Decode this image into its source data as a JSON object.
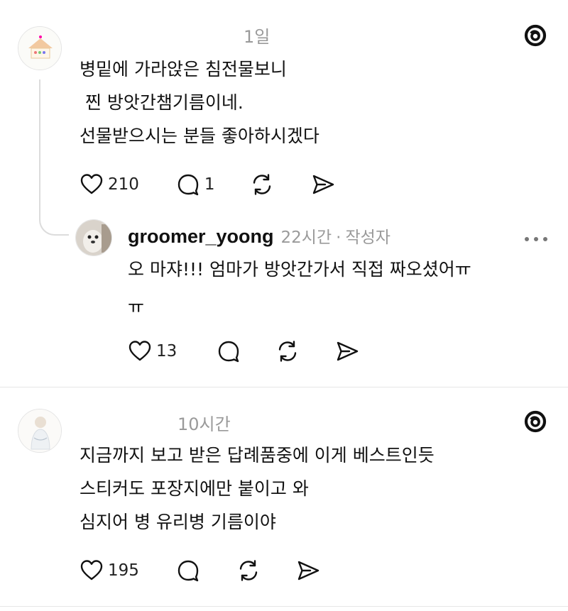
{
  "comment1": {
    "time": "1일",
    "lines": [
      "병밑에 가라앉은 침전물보니",
      " 찐 방앗간챔기름이네.",
      "선물받으시는 분들 좋아하시겠다"
    ],
    "likes": "210",
    "replies": "1"
  },
  "reply1": {
    "username": "groomer_yoong",
    "time": "22시간",
    "separator": "·",
    "author_badge": "작성자",
    "lines": [
      "오 마쟈!!! 엄마가 방앗간가서 직접 짜오셨어ㅠ",
      "ㅠ"
    ],
    "likes": "13"
  },
  "comment2": {
    "time": "10시간",
    "lines": [
      "지금까지 보고 받은 답례품중에 이게 베스트인듯",
      "스티커도 포장지에만 붙이고 와",
      "심지어 병 유리병 기름이야"
    ],
    "likes": "195"
  },
  "icons": {
    "threads": "threads-logo-icon",
    "like": "heart-icon",
    "reply": "speech-bubble-icon",
    "repost": "repost-icon",
    "share": "send-icon",
    "more": "more-icon"
  },
  "colors": {
    "text": "#111111",
    "muted": "#9a9a9a",
    "divider": "#e6e6e6"
  }
}
